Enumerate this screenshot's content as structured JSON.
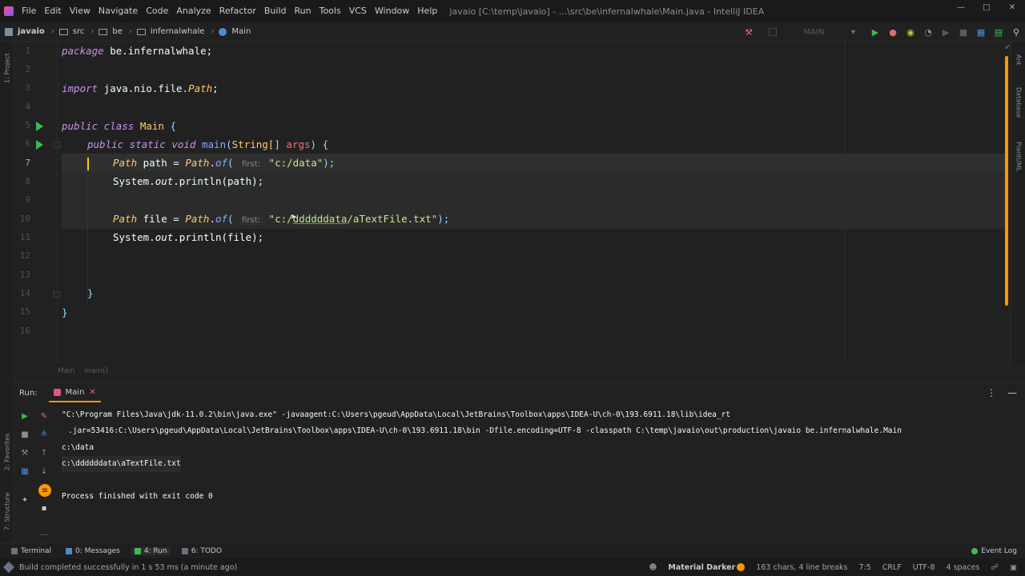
{
  "window": {
    "title": "javaio [C:\\temp\\javaio] - ...\\src\\be\\infernalwhale\\Main.java - IntelliJ IDEA",
    "menu": [
      "File",
      "Edit",
      "View",
      "Navigate",
      "Code",
      "Analyze",
      "Refactor",
      "Build",
      "Run",
      "Tools",
      "VCS",
      "Window",
      "Help"
    ]
  },
  "navbar": {
    "project": "javaio",
    "src": "src",
    "pkg1": "be",
    "pkg2": "infernalwhale",
    "cls": "Main",
    "run_config": "MAIN"
  },
  "left_tools": {
    "project": "1: Project",
    "favorites": "2: Favorites",
    "structure": "7: Structure"
  },
  "right_tools": {
    "ant": "Ant",
    "database": "Database",
    "plantuml": "PlantUML"
  },
  "editor": {
    "line_numbers": [
      "1",
      "2",
      "3",
      "4",
      "5",
      "6",
      "7",
      "8",
      "9",
      "10",
      "11",
      "12",
      "13",
      "14",
      "15",
      "16"
    ],
    "current_line": "7",
    "l1_kw": "package",
    "l1_rest": " be.infernalwhale;",
    "l3_kw": "import",
    "l3_pkg": " java.nio.file.",
    "l3_cls": "Path",
    "l3_end": ";",
    "l5_kw": "public class",
    "l5_cls": "Main",
    "l5_brace": "{",
    "l6_kw": "public static void",
    "l6_fn": "main",
    "l6_paren_open": "(",
    "l6_type": "String[]",
    "l6_arg": "args",
    "l6_paren_close": ")",
    "l6_brace": "{",
    "l7_type": "Path",
    "l7_var": " path = ",
    "l7_cls": "Path",
    "l7_dot": ".",
    "l7_fn": "of",
    "l7_open": "(",
    "hint": "first:",
    "l7_str": "\"c:/data\"",
    "l7_end": ");",
    "l8_sys": "System.",
    "l8_out": "out",
    "l8_rest": ".println(path);",
    "l10_type": "Path",
    "l10_var": " file = ",
    "l10_cls": "Path",
    "l10_dot": ".",
    "l10_fn": "of",
    "l10_open": "(",
    "l10_str_a": "\"c:/",
    "l10_str_b": "ddddddata",
    "l10_str_c": "/aTextFile.txt\"",
    "l10_end": ");",
    "l11_sys": "System.",
    "l11_out": "out",
    "l11_rest": ".println(file);",
    "l14_brace": "}",
    "l15_brace": "}",
    "breadcrumb": [
      "Main",
      "main()"
    ]
  },
  "run_panel": {
    "label": "Run:",
    "tab": "Main",
    "console": [
      "\"C:\\Program Files\\Java\\jdk-11.0.2\\bin\\java.exe\" -javaagent:C:\\Users\\pgeud\\AppData\\Local\\JetBrains\\Toolbox\\apps\\IDEA-U\\ch-0\\193.6911.18\\lib\\idea_rt",
      ".jar=53416:C:\\Users\\pgeud\\AppData\\Local\\JetBrains\\Toolbox\\apps\\IDEA-U\\ch-0\\193.6911.18\\bin -Dfile.encoding=UTF-8 -classpath C:\\temp\\javaio\\out\\production\\javaio be.infernalwhale.Main",
      "c:\\data",
      "c:\\ddddddata\\aTextFile.txt",
      "",
      "Process finished with exit code 0"
    ]
  },
  "bottom_tabs": {
    "terminal": "Terminal",
    "messages": "0: Messages",
    "run": "4: Run",
    "todo": "6: TODO",
    "event_log": "Event Log"
  },
  "status": {
    "build": "Build completed successfully in 1 s 53 ms (a minute ago)",
    "theme": "Material Darker",
    "chars": "163 chars, 4 line breaks",
    "pos": "7:5",
    "eol": "CRLF",
    "enc": "UTF-8",
    "indent": "4 spaces"
  },
  "colors": {
    "accent": "#ff9800",
    "keyword": "#c792ea",
    "string": "#c3e88d",
    "class": "#ffcb6b",
    "function": "#82aaff",
    "run_green": "#3fb950"
  }
}
